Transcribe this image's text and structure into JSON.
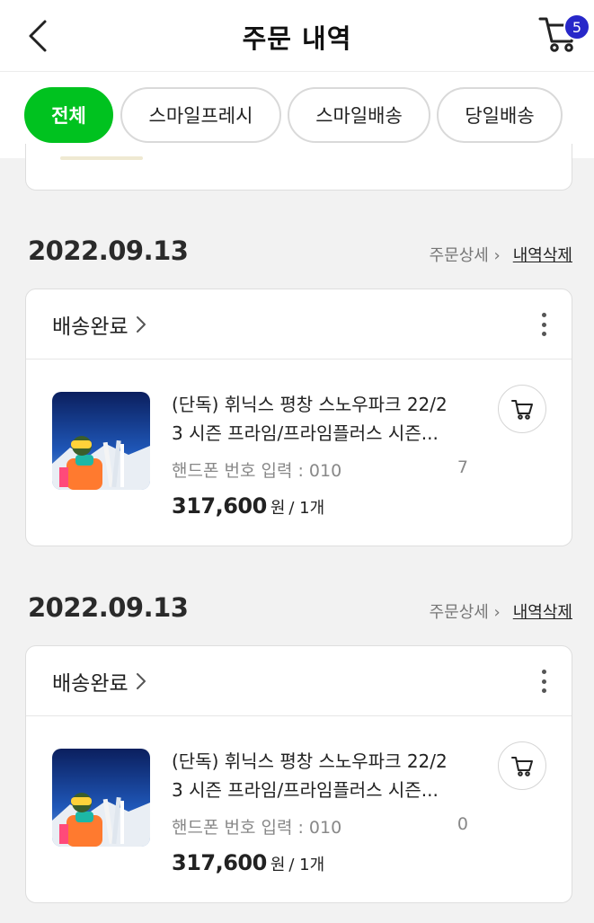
{
  "header": {
    "title": "주문 내역",
    "back_icon": "chevron-left-icon",
    "cart_icon": "cart-icon",
    "cart_count": "5"
  },
  "filters": [
    {
      "label": "전체",
      "active": true
    },
    {
      "label": "스마일프레시",
      "active": false
    },
    {
      "label": "스마일배송",
      "active": false
    },
    {
      "label": "당일배송",
      "active": false
    }
  ],
  "orders": [
    {
      "date": "2022.09.13",
      "detail_link": "주문상세 ›",
      "delete_link": "내역삭제",
      "status": "배송완료",
      "product": {
        "name_line1": "(단독) 휘닉스 평창 스노우파크 22/2",
        "name_line2": "3 시즌 프라임/프라임플러스 시즌...",
        "option_text": "핸드폰 번호 입력 : 010",
        "option_tail": "7",
        "price": "317,600",
        "price_unit": "원",
        "quantity": "/ 1개"
      }
    },
    {
      "date": "2022.09.13",
      "detail_link": "주문상세 ›",
      "delete_link": "내역삭제",
      "status": "배송완료",
      "product": {
        "name_line1": "(단독) 휘닉스 평창 스노우파크 22/2",
        "name_line2": "3 시즌 프라임/프라임플러스 시즌...",
        "option_text": "핸드폰 번호 입력 : 010",
        "option_tail": "0",
        "price": "317,600",
        "price_unit": "원",
        "quantity": "/ 1개"
      }
    }
  ],
  "colors": {
    "accent": "#00c21f",
    "badge": "#2727c9"
  }
}
